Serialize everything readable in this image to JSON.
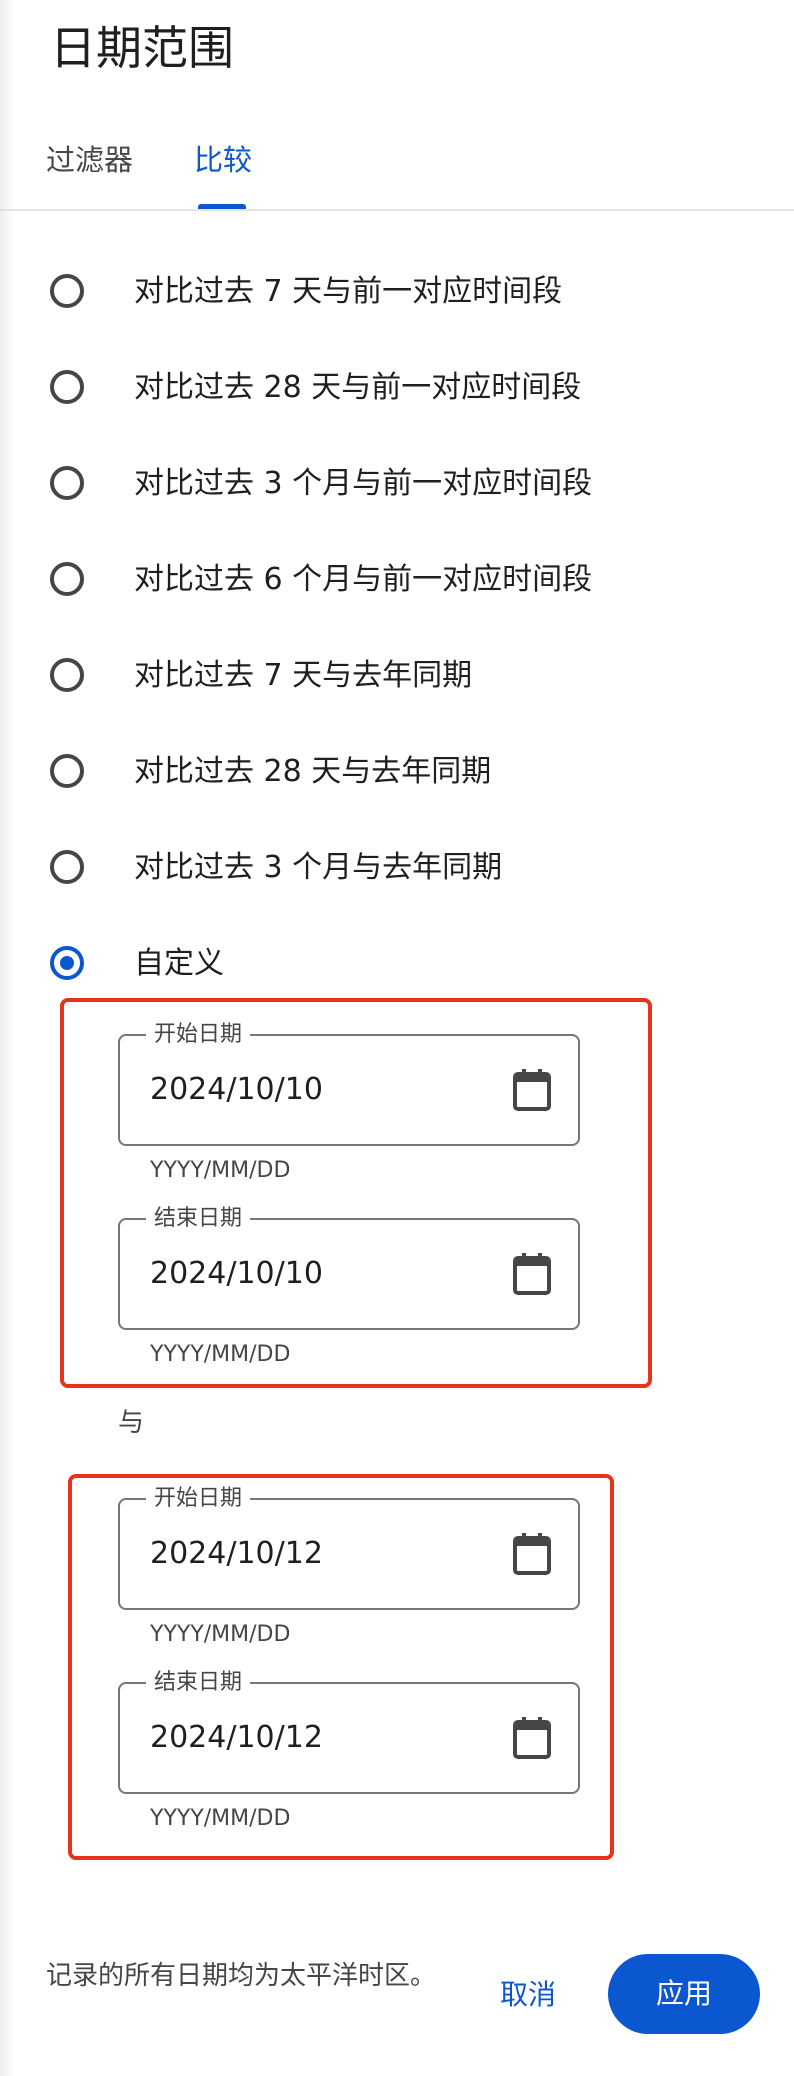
{
  "dialog": {
    "title": "日期范围"
  },
  "tabs": [
    {
      "label": "过滤器",
      "selected": false
    },
    {
      "label": "比较",
      "selected": true
    }
  ],
  "options": [
    {
      "label": "对比过去 7 天与前一对应时间段",
      "selected": false
    },
    {
      "label": "对比过去 28 天与前一对应时间段",
      "selected": false
    },
    {
      "label": "对比过去 3 个月与前一对应时间段",
      "selected": false
    },
    {
      "label": "对比过去 6 个月与前一对应时间段",
      "selected": false
    },
    {
      "label": "对比过去 7 天与去年同期",
      "selected": false
    },
    {
      "label": "对比过去 28 天与去年同期",
      "selected": false
    },
    {
      "label": "对比过去 3 个月与去年同期",
      "selected": false
    },
    {
      "label": "自定义",
      "selected": true
    }
  ],
  "custom": {
    "range1": {
      "start": {
        "label": "开始日期",
        "value": "2024/10/10",
        "helper": "YYYY/MM/DD"
      },
      "end": {
        "label": "结束日期",
        "value": "2024/10/10",
        "helper": "YYYY/MM/DD"
      }
    },
    "connector": "与",
    "range2": {
      "start": {
        "label": "开始日期",
        "value": "2024/10/12",
        "helper": "YYYY/MM/DD"
      },
      "end": {
        "label": "结束日期",
        "value": "2024/10/12",
        "helper": "YYYY/MM/DD"
      }
    }
  },
  "footer": {
    "note": "记录的所有日期均为太平洋时区。",
    "cancel_label": "取消",
    "apply_label": "应用"
  },
  "colors": {
    "accent": "#0b57d0",
    "highlight": "#e8331c"
  }
}
